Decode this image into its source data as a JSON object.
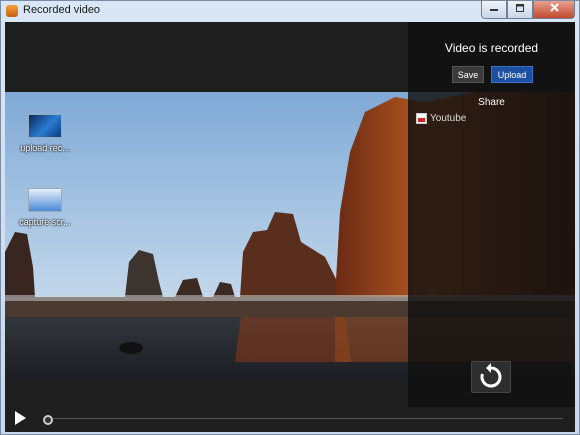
{
  "window": {
    "title": "Recorded video",
    "controls": [
      "minimize",
      "maximize",
      "close"
    ]
  },
  "desktop_icons": [
    {
      "label": "upload rec...",
      "icon": "video-file-icon"
    },
    {
      "label": "capture scr...",
      "icon": "window-app-icon"
    }
  ],
  "panel": {
    "title": "Video is recorded",
    "save_label": "Save",
    "upload_label": "Upload",
    "share_label": "Share",
    "share_items": [
      {
        "label": "Youtube",
        "icon": "youtube-icon"
      }
    ]
  },
  "player": {
    "progress": 0.0
  },
  "colors": {
    "upload_button": "#1d4fa0",
    "background": "#1b1b1b"
  }
}
